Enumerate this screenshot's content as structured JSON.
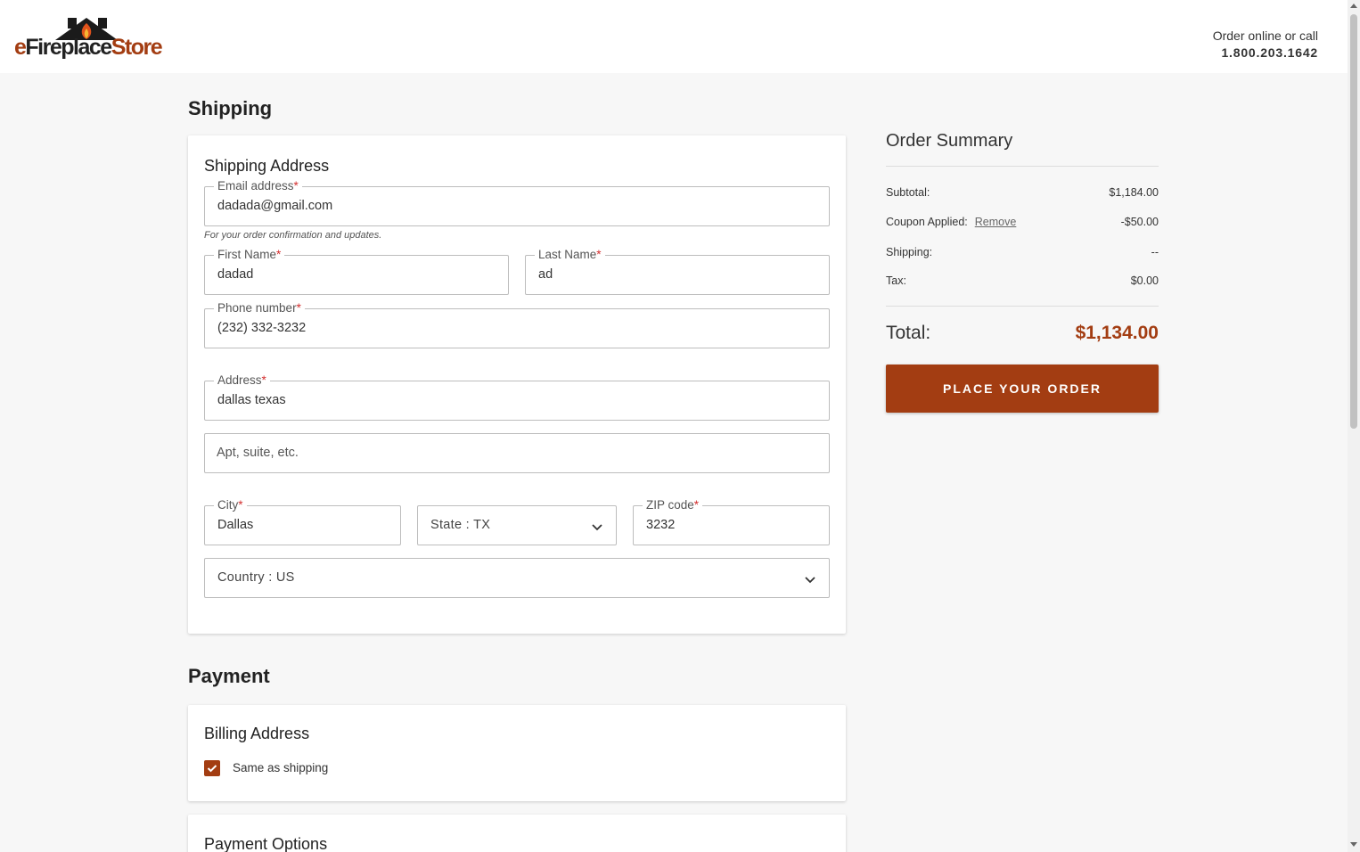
{
  "brand": {
    "logo_e": "e",
    "logo_fireplace": "Fireplace",
    "logo_store": "Store",
    "contact_text": "Order online or call",
    "contact_phone": "1.800.203.1642"
  },
  "shipping": {
    "section_title": "Shipping",
    "card_title": "Shipping Address",
    "email": {
      "label": "Email address",
      "value": "dadada@gmail.com",
      "helper": "For your order confirmation and updates."
    },
    "first_name": {
      "label": "First Name",
      "value": "dadad"
    },
    "last_name": {
      "label": "Last Name",
      "value": "ad"
    },
    "phone": {
      "label": "Phone number",
      "value": "(232) 332-3232"
    },
    "address": {
      "label": "Address",
      "value": "dallas texas"
    },
    "apt": {
      "placeholder": "Apt, suite, etc."
    },
    "city": {
      "label": "City",
      "value": "Dallas"
    },
    "state": {
      "value": "State : TX"
    },
    "zip": {
      "label": "ZIP code",
      "value": "3232"
    },
    "country": {
      "value": "Country : US"
    },
    "required_mark": "*"
  },
  "payment": {
    "section_title": "Payment",
    "billing_title": "Billing Address",
    "same_as_shipping": "Same as shipping",
    "same_as_shipping_checked": true,
    "options_title": "Payment Options"
  },
  "summary": {
    "title": "Order Summary",
    "subtotal_label": "Subtotal:",
    "subtotal_value": "$1,184.00",
    "coupon_label": "Coupon Applied:",
    "coupon_remove": "Remove",
    "coupon_value": "-$50.00",
    "shipping_label": "Shipping:",
    "shipping_value": "--",
    "tax_label": "Tax:",
    "tax_value": "$0.00",
    "total_label": "Total:",
    "total_value": "$1,134.00",
    "place_order": "PLACE YOUR ORDER"
  },
  "colors": {
    "accent": "#a33d12"
  }
}
